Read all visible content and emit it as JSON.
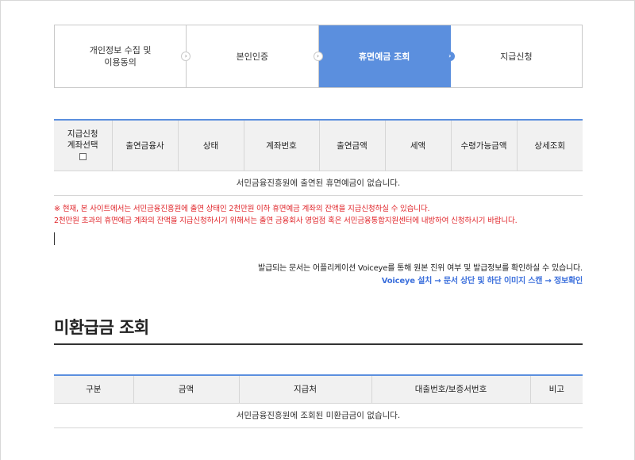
{
  "steps": [
    {
      "label": "개인정보 수집 및\n이용동의",
      "active": false
    },
    {
      "label": "본인인증",
      "active": false
    },
    {
      "label": "휴면예금 조회",
      "active": true
    },
    {
      "label": "지급신청",
      "active": false
    }
  ],
  "step_separator_glyph": "›",
  "deposit_table": {
    "headers": [
      "지급신청\n계좌선택",
      "출연금융사",
      "상태",
      "계좌번호",
      "출연금액",
      "세액",
      "수령가능금액",
      "상세조회"
    ],
    "empty_message": "서민금융진흥원에 출연된 휴면예금이 없습니다."
  },
  "notice": {
    "line1": "※ 현재, 본 사이트에서는 서민금융진흥원에 출연 상태인 2천만원 이하 휴면예금 계좌의 잔액을 지급신청하실 수 있습니다.",
    "line2": "2천만원 초과의 휴면예금 계좌의 잔액을 지급신청하시기 위해서는 출연 금융회사 영업점 혹은 서민금융통합지원센터에 내방하여 신청하시기 바랍니다."
  },
  "voiceye": {
    "line1": "발급되는 문서는 어플리케이션 Voiceye를 통해 원본 진위 여부 및 발급정보를 확인하실 수 있습니다.",
    "line2": "Voiceye 설치 → 문서 상단 및 하단 이미지 스캔 → 정보확인"
  },
  "unpaid": {
    "title": "미환급금 조회",
    "headers": [
      "구분",
      "금액",
      "지급처",
      "대출번호/보증서번호",
      "비고"
    ],
    "empty_message": "서민금융진흥원에 조회된 미환급금이 없습니다."
  },
  "colors": {
    "accent": "#5b8fde",
    "notice_red": "#e0252a",
    "link_blue": "#3b6fdc"
  }
}
